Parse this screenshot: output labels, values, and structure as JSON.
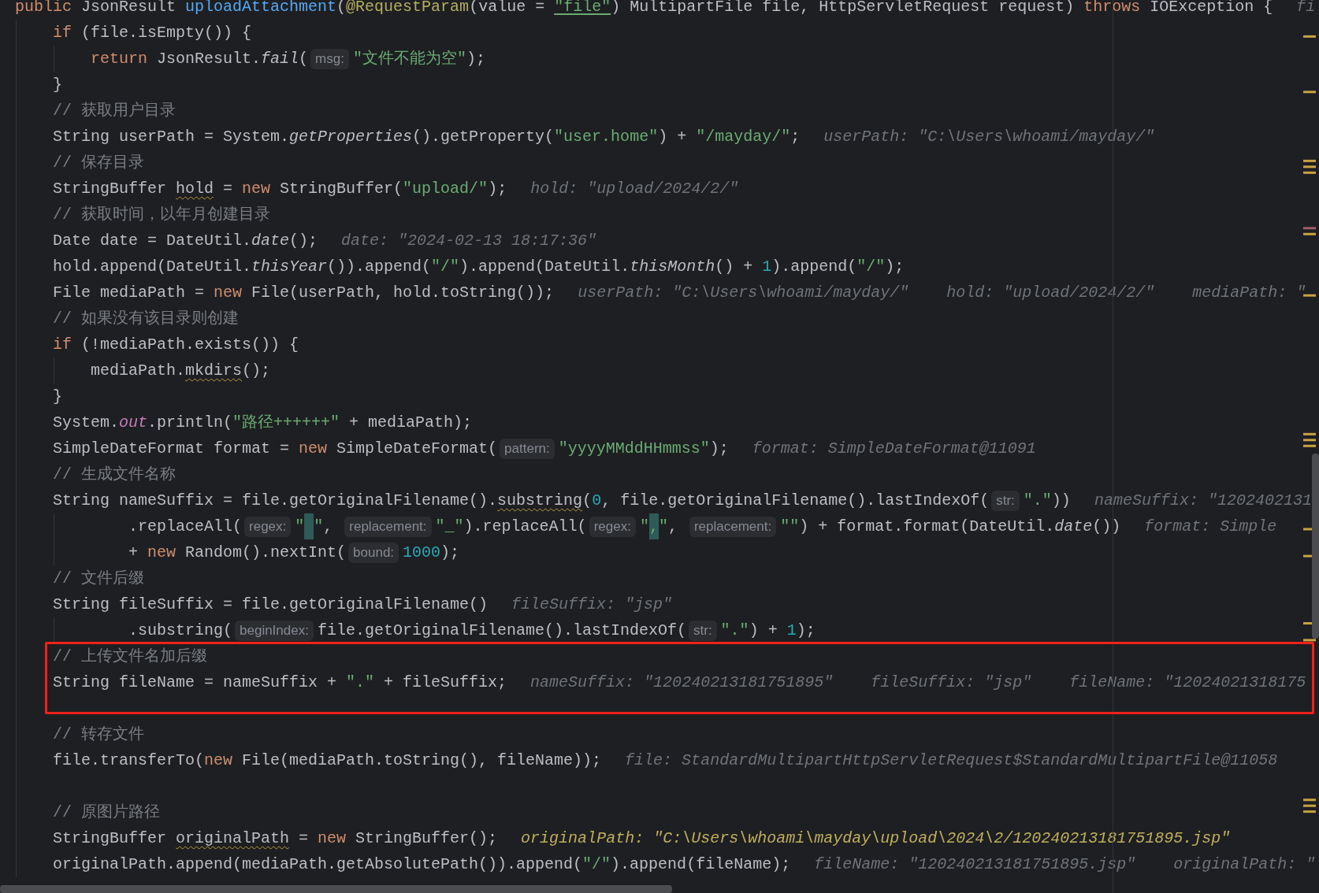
{
  "editor": {
    "lines": [
      {
        "tokens": [
          {
            "kind": "kw",
            "text": "public"
          },
          {
            "kind": "p",
            "text": " JsonResult "
          },
          {
            "kind": "fn",
            "text": "uploadAttachment"
          },
          {
            "kind": "p",
            "text": "("
          },
          {
            "kind": "ann",
            "text": "@RequestParam"
          },
          {
            "kind": "p",
            "text": "(value = "
          },
          {
            "kind": "stru",
            "text": "\"file\""
          },
          {
            "kind": "p",
            "text": ") MultipartFile file, HttpServletRequest request) "
          },
          {
            "kind": "kw",
            "text": "throws"
          },
          {
            "kind": "p",
            "text": " IOException {"
          },
          {
            "kind": "dbg",
            "text": "fi"
          }
        ],
        "children": [
          {
            "tokens": [
              {
                "kind": "kw",
                "text": "if"
              },
              {
                "kind": "p",
                "text": " (file.isEmpty()) {"
              }
            ],
            "children": [
              {
                "tokens": [
                  {
                    "kind": "kw",
                    "text": "return"
                  },
                  {
                    "kind": "p",
                    "text": " JsonResult."
                  },
                  {
                    "kind": "i",
                    "text": "fail"
                  },
                  {
                    "kind": "p",
                    "text": "("
                  },
                  {
                    "kind": "hint",
                    "text": "msg:"
                  },
                  {
                    "kind": "str",
                    "text": "\"文件不能为空\""
                  },
                  {
                    "kind": "p",
                    "text": ");"
                  }
                ]
              }
            ]
          },
          {
            "tokens": [
              {
                "kind": "p",
                "text": "}"
              }
            ]
          },
          {
            "tokens": [
              {
                "kind": "c",
                "text": "// 获取用户目录"
              }
            ]
          },
          {
            "tokens": [
              {
                "kind": "p",
                "text": "String userPath = System."
              },
              {
                "kind": "i",
                "text": "getProperties"
              },
              {
                "kind": "p",
                "text": "().getProperty("
              },
              {
                "kind": "str",
                "text": "\"user.home\""
              },
              {
                "kind": "p",
                "text": ") + "
              },
              {
                "kind": "str",
                "text": "\"/mayday/\""
              },
              {
                "kind": "p",
                "text": ";"
              },
              {
                "kind": "dbg",
                "text": "userPath: \"C:\\Users\\whoami/mayday/\""
              }
            ]
          },
          {
            "tokens": [
              {
                "kind": "c",
                "text": "// 保存目录"
              }
            ]
          },
          {
            "tokens": [
              {
                "kind": "p",
                "text": "StringBuffer "
              },
              {
                "kind": "w",
                "text": "hold"
              },
              {
                "kind": "p",
                "text": " = "
              },
              {
                "kind": "kw",
                "text": "new"
              },
              {
                "kind": "p",
                "text": " StringBuffer("
              },
              {
                "kind": "str",
                "text": "\"upload/\""
              },
              {
                "kind": "p",
                "text": ");"
              },
              {
                "kind": "dbg",
                "text": "hold: \"upload/2024/2/\""
              }
            ]
          },
          {
            "tokens": [
              {
                "kind": "c",
                "text": "// 获取时间，以年月创建目录"
              }
            ]
          },
          {
            "tokens": [
              {
                "kind": "p",
                "text": "Date date = DateUtil."
              },
              {
                "kind": "i",
                "text": "date"
              },
              {
                "kind": "p",
                "text": "();"
              },
              {
                "kind": "dbg",
                "text": "date: \"2024-02-13 18:17:36\""
              }
            ]
          },
          {
            "tokens": [
              {
                "kind": "p",
                "text": "hold.append(DateUtil."
              },
              {
                "kind": "i",
                "text": "thisYear"
              },
              {
                "kind": "p",
                "text": "()).append("
              },
              {
                "kind": "str",
                "text": "\"/\""
              },
              {
                "kind": "p",
                "text": ").append(DateUtil."
              },
              {
                "kind": "i",
                "text": "thisMonth"
              },
              {
                "kind": "p",
                "text": "() + "
              },
              {
                "kind": "num",
                "text": "1"
              },
              {
                "kind": "p",
                "text": ").append("
              },
              {
                "kind": "str",
                "text": "\"/\""
              },
              {
                "kind": "p",
                "text": ");"
              }
            ]
          },
          {
            "tokens": [
              {
                "kind": "p",
                "text": "File mediaPath = "
              },
              {
                "kind": "kw",
                "text": "new"
              },
              {
                "kind": "p",
                "text": " File(userPath, hold.toString());"
              },
              {
                "kind": "dbg",
                "text": "userPath: \"C:\\Users\\whoami/mayday/\""
              },
              {
                "kind": "dbg",
                "text": "hold: \"upload/2024/2/\""
              },
              {
                "kind": "dbg",
                "text": "mediaPath: \""
              }
            ]
          },
          {
            "tokens": [
              {
                "kind": "c",
                "text": "// 如果没有该目录则创建"
              }
            ]
          },
          {
            "tokens": [
              {
                "kind": "kw",
                "text": "if"
              },
              {
                "kind": "p",
                "text": " (!mediaPath.exists()) {"
              }
            ],
            "children": [
              {
                "tokens": [
                  {
                    "kind": "p",
                    "text": "mediaPath."
                  },
                  {
                    "kind": "w",
                    "text": "mkdirs"
                  },
                  {
                    "kind": "p",
                    "text": "();"
                  }
                ]
              }
            ]
          },
          {
            "tokens": [
              {
                "kind": "p",
                "text": "}"
              }
            ]
          },
          {
            "tokens": [
              {
                "kind": "p",
                "text": "System."
              },
              {
                "kind": "f",
                "text": "out"
              },
              {
                "kind": "p",
                "text": ".println("
              },
              {
                "kind": "str",
                "text": "\"路径++++++\""
              },
              {
                "kind": "p",
                "text": " + mediaPath);"
              }
            ]
          },
          {
            "tokens": [
              {
                "kind": "p",
                "text": "SimpleDateFormat format = "
              },
              {
                "kind": "kw",
                "text": "new"
              },
              {
                "kind": "p",
                "text": " SimpleDateFormat("
              },
              {
                "kind": "hint",
                "text": "pattern:"
              },
              {
                "kind": "str",
                "text": "\"yyyyMMddHHmmss\""
              },
              {
                "kind": "p",
                "text": ");"
              },
              {
                "kind": "dbg",
                "text": "format: SimpleDateFormat@11091"
              }
            ]
          },
          {
            "tokens": [
              {
                "kind": "c",
                "text": "// 生成文件名称"
              }
            ]
          },
          {
            "tokens": [
              {
                "kind": "p",
                "text": "String nameSuffix = file.getOriginalFilename()."
              },
              {
                "kind": "w",
                "text": "substring"
              },
              {
                "kind": "p",
                "text": "("
              },
              {
                "kind": "num",
                "text": "0"
              },
              {
                "kind": "p",
                "text": ", file.getOriginalFilename().lastIndexOf("
              },
              {
                "kind": "hint",
                "text": "str:"
              },
              {
                "kind": "str",
                "text": "\".\""
              },
              {
                "kind": "p",
                "text": "))"
              },
              {
                "kind": "dbg",
                "text": "nameSuffix: \"1202402131"
              }
            ],
            "continued": [
              {
                "tokens": [
                  {
                    "kind": "p",
                    "text": ".replaceAll("
                  },
                  {
                    "kind": "hint",
                    "text": "regex:"
                  },
                  {
                    "kind": "str",
                    "text": "\" \"",
                    "marked": true
                  },
                  {
                    "kind": "p",
                    "text": ", "
                  },
                  {
                    "kind": "hint",
                    "text": "replacement:"
                  },
                  {
                    "kind": "str",
                    "text": "\"_\""
                  },
                  {
                    "kind": "p",
                    "text": ").replaceAll("
                  },
                  {
                    "kind": "hint",
                    "text": "regex:"
                  },
                  {
                    "kind": "str",
                    "text": "\",\"",
                    "marked": true
                  },
                  {
                    "kind": "p",
                    "text": ", "
                  },
                  {
                    "kind": "hint",
                    "text": "replacement:"
                  },
                  {
                    "kind": "str",
                    "text": "\"\""
                  },
                  {
                    "kind": "p",
                    "text": ") + format.format(DateUtil."
                  },
                  {
                    "kind": "i",
                    "text": "date"
                  },
                  {
                    "kind": "p",
                    "text": "())"
                  },
                  {
                    "kind": "dbg",
                    "text": "format: Simple"
                  }
                ]
              },
              {
                "tokens": [
                  {
                    "kind": "p",
                    "text": "+ "
                  },
                  {
                    "kind": "kw",
                    "text": "new"
                  },
                  {
                    "kind": "p",
                    "text": " Random().nextInt("
                  },
                  {
                    "kind": "hint",
                    "text": "bound:"
                  },
                  {
                    "kind": "num",
                    "text": "1000"
                  },
                  {
                    "kind": "p",
                    "text": ");"
                  }
                ]
              }
            ]
          },
          {
            "tokens": [
              {
                "kind": "c",
                "text": "// 文件后缀"
              }
            ]
          },
          {
            "tokens": [
              {
                "kind": "p",
                "text": "String fileSuffix = file.getOriginalFilename()"
              },
              {
                "kind": "dbg",
                "text": "fileSuffix: \"jsp\""
              }
            ],
            "continued": [
              {
                "tokens": [
                  {
                    "kind": "p",
                    "text": ".substring("
                  },
                  {
                    "kind": "hint",
                    "text": "beginIndex:"
                  },
                  {
                    "kind": "p",
                    "text": "file.getOriginalFilename().lastIndexOf("
                  },
                  {
                    "kind": "hint",
                    "text": "str:"
                  },
                  {
                    "kind": "str",
                    "text": "\".\""
                  },
                  {
                    "kind": "p",
                    "text": ") + "
                  },
                  {
                    "kind": "num",
                    "text": "1"
                  },
                  {
                    "kind": "p",
                    "text": ");"
                  }
                ]
              }
            ]
          },
          {
            "tokens": [
              {
                "kind": "c",
                "text": "// 上传文件名加后缀"
              }
            ]
          },
          {
            "tokens": [
              {
                "kind": "p",
                "text": "String fileName = nameSuffix + "
              },
              {
                "kind": "str",
                "text": "\".\""
              },
              {
                "kind": "p",
                "text": " + fileSuffix;"
              },
              {
                "kind": "dbg",
                "text": "nameSuffix: \"120240213181751895\""
              },
              {
                "kind": "dbg",
                "text": "fileSuffix: \"jsp\""
              },
              {
                "kind": "dbg",
                "text": "fileName: \"12024021318175"
              }
            ]
          },
          {
            "kind": "blank"
          },
          {
            "tokens": [
              {
                "kind": "c",
                "text": "// 转存文件"
              }
            ]
          },
          {
            "tokens": [
              {
                "kind": "p",
                "text": "file.transferTo("
              },
              {
                "kind": "kw",
                "text": "new"
              },
              {
                "kind": "p",
                "text": " File(mediaPath.toString(), fileName));"
              },
              {
                "kind": "dbg",
                "text": "file: StandardMultipartHttpServletRequest$StandardMultipartFile@11058"
              }
            ]
          },
          {
            "kind": "blank"
          },
          {
            "tokens": [
              {
                "kind": "c",
                "text": "// 原图片路径"
              }
            ]
          },
          {
            "tokens": [
              {
                "kind": "p",
                "text": "StringBuffer "
              },
              {
                "kind": "w",
                "text": "originalPath"
              },
              {
                "kind": "p",
                "text": " = "
              },
              {
                "kind": "kw",
                "text": "new"
              },
              {
                "kind": "p",
                "text": " StringBuffer();"
              },
              {
                "kind": "dbgc",
                "text": "originalPath: \"C:\\Users\\whoami\\mayday\\upload\\2024\\2/120240213181751895.jsp\""
              }
            ]
          },
          {
            "tokens": [
              {
                "kind": "p",
                "text": "originalPath.append(mediaPath.getAbsolutePath()).append("
              },
              {
                "kind": "str",
                "text": "\"/\""
              },
              {
                "kind": "p",
                "text": ").append(fileName);"
              },
              {
                "kind": "dbg",
                "text": "fileName: \"120240213181751895.jsp\""
              },
              {
                "kind": "dbg",
                "text": "originalPath: \""
              }
            ]
          }
        ]
      }
    ]
  }
}
